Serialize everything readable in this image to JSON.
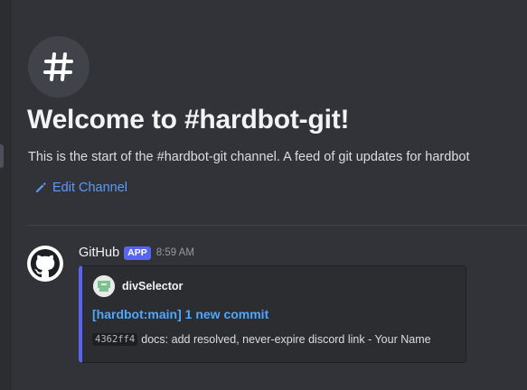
{
  "channel": {
    "icon": "hashtag-icon",
    "title": "Welcome to #hardbot-git!",
    "description": "This is the start of the #hardbot-git channel. A feed of git updates for hardbot",
    "edit_label": "Edit Channel"
  },
  "message": {
    "author": "GitHub",
    "badge": "APP",
    "timestamp": "8:59 AM",
    "avatar_icon": "github-icon",
    "embed": {
      "accent_color": "#5865f2",
      "author_name": "divSelector",
      "title": "[hardbot:main] 1 new commit",
      "commit_hash": "4362ff4",
      "commit_message": "docs: add resolved, never-expire discord link - Your Name"
    }
  },
  "colors": {
    "background": "#313338",
    "link": "#4ea7ff",
    "badge": "#5865f2"
  }
}
